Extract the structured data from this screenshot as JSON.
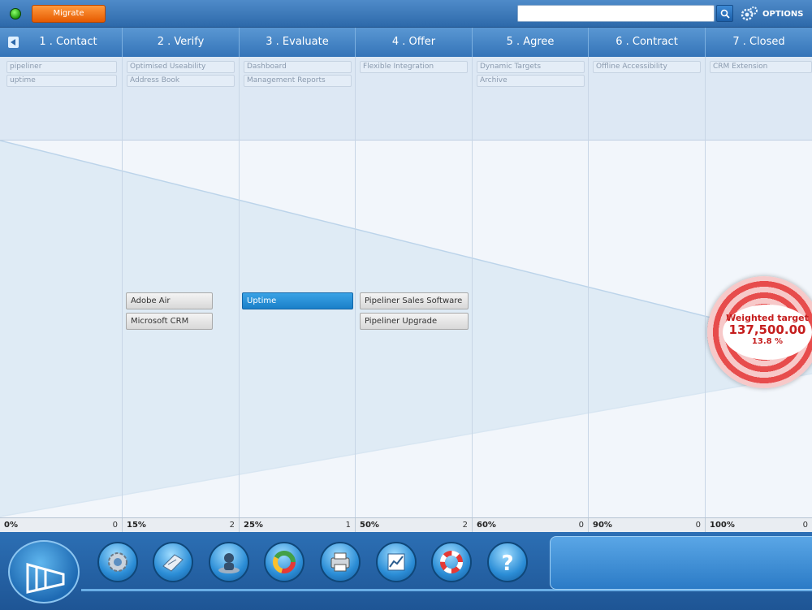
{
  "topbar": {
    "migrate_label": "Migrate",
    "search_placeholder": "",
    "options_label": "OPTIONS"
  },
  "phases": [
    {
      "label": "1 . Contact",
      "percent": "0%",
      "count": "0"
    },
    {
      "label": "2 . Verify",
      "percent": "15%",
      "count": "2"
    },
    {
      "label": "3 . Evaluate",
      "percent": "25%",
      "count": "1"
    },
    {
      "label": "4 . Offer",
      "percent": "50%",
      "count": "2"
    },
    {
      "label": "5 . Agree",
      "percent": "60%",
      "count": "0"
    },
    {
      "label": "6 . Contract",
      "percent": "90%",
      "count": "0"
    },
    {
      "label": "7 . Closed",
      "percent": "100%",
      "count": "0"
    }
  ],
  "tags": {
    "c1": [
      "pipeliner",
      "uptime"
    ],
    "c2": [
      "Optimised Useability",
      "Address Book"
    ],
    "c3": [
      "Dashboard",
      "Management Reports"
    ],
    "c4": [
      "Flexible Integration"
    ],
    "c5": [
      "Dynamic Targets",
      "Archive"
    ],
    "c6": [
      "Offline Accessibility"
    ],
    "c7": [
      "CRM Extension"
    ]
  },
  "cards": {
    "c2": [
      "Adobe Air",
      "Microsoft CRM"
    ],
    "c3": [
      "Uptime"
    ],
    "c4": [
      "Pipeliner Sales Software",
      "Pipeliner Upgrade"
    ]
  },
  "target": {
    "label": "Weighted target",
    "value": "137,500.00",
    "percent": "13.8 %"
  },
  "dock": {
    "buttons": [
      "settings-icon",
      "address-book-icon",
      "contact-icon",
      "donut-chart-icon",
      "printer-icon",
      "line-chart-icon",
      "lifebuoy-icon",
      "help-icon"
    ]
  },
  "colors": {
    "accent": "#2d69aa",
    "migrate": "#f06a10",
    "target": "#e74c4c"
  }
}
